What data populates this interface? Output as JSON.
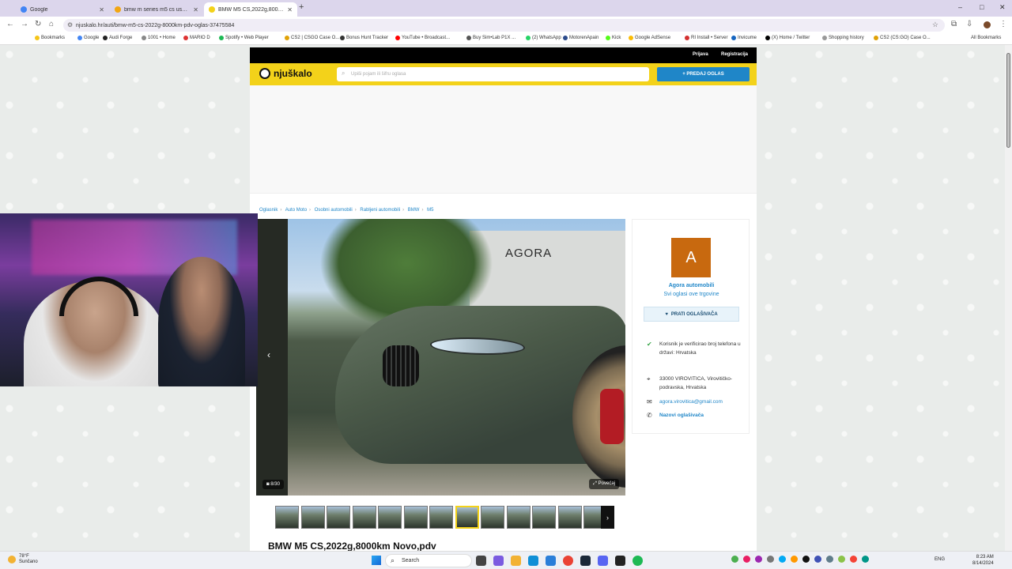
{
  "browser": {
    "tabs": [
      {
        "label": "Google",
        "active": false,
        "favicon_color": "#4285f4"
      },
      {
        "label": "bmw m series m5 cs used – Sea",
        "active": false,
        "favicon_color": "#f2a612"
      },
      {
        "label": "BMW M5 CS,2022g,8000km No...",
        "active": true,
        "favicon_color": "#f3d21a"
      }
    ],
    "new_tab": "+",
    "url": "njuskalo.hr/auti/bmw-m5-cs-2022g-8000km-pdv-oglas-37475584",
    "window_controls": [
      "–",
      "□",
      "✕"
    ],
    "bookmarks": [
      {
        "label": "Bookmarks",
        "color": "#f5c518"
      },
      {
        "label": "Google",
        "color": "#4285f4"
      },
      {
        "label": "Audi Forge",
        "color": "#222"
      },
      {
        "label": "1001 • Home",
        "color": "#888"
      },
      {
        "label": "MARIO D",
        "color": "#d33"
      },
      {
        "label": "Spotify • Web Player",
        "color": "#1db954"
      },
      {
        "label": "CS2 | CSGO Case O...",
        "color": "#e0a106"
      },
      {
        "label": "Bonus Hunt Tracker",
        "color": "#333"
      },
      {
        "label": "YouTube • Broadcast...",
        "color": "#ff0000"
      },
      {
        "label": "Buy Sim•Lab P1X ...",
        "color": "#555"
      },
      {
        "label": "(2) WhatsApp",
        "color": "#25d366"
      },
      {
        "label": "MotorenApain",
        "color": "#2b4a8b"
      },
      {
        "label": "Kick",
        "color": "#53fc18"
      },
      {
        "label": "Google AdSense",
        "color": "#fbbc04"
      },
      {
        "label": "RI Install • Server",
        "color": "#d32f2f"
      },
      {
        "label": "Invicume",
        "color": "#1565c0"
      },
      {
        "label": "(X) Home / Twitter",
        "color": "#000"
      },
      {
        "label": "Shopping history",
        "color": "#999"
      },
      {
        "label": "CS2 (CS:GO) Case O...",
        "color": "#e0a106"
      }
    ],
    "all_bookmarks": "All Bookmarks"
  },
  "site": {
    "top_links": {
      "login": "Prijava",
      "register": "Registracija"
    },
    "logo": "njuškalo",
    "search_placeholder": "Upiši pojam ili šifru oglasa",
    "sell_button": "+ PREDAJ OGLAS",
    "breadcrumb": [
      "Oglasnik",
      "Auto Moto",
      "Osobni automobili",
      "Rabljeni automobili",
      "BMW",
      "M5"
    ],
    "gallery": {
      "photo_counter": "8/30",
      "enlarge": "Povećaj",
      "sign_text": "AGORA",
      "prev": "‹",
      "next": "›",
      "thumb_count": 13,
      "selected_thumb": 7
    },
    "title": "BMW M5 CS,2022g,8000km Novo,pdv",
    "seller": {
      "avatar_letter": "A",
      "avatar_color": "#c8690f",
      "name": "Agora automobili",
      "all_ads": "Svi oglasi ove trgovine",
      "follow": "PRATI OGLAŠIVAČA",
      "verified": "Korisnik je verificirao broj telefona u državi: Hrvatska",
      "address": "33000 VIROVITICA, Virovitičko-podravska, Hrvatska",
      "email": "agora.virovitica@gmail.com",
      "call": "Nazovi oglašivača"
    }
  },
  "taskbar": {
    "weather_temp": "78°F",
    "weather_desc": "Sunčano",
    "search": "Search",
    "language": "ENG",
    "time": "8:23 AM",
    "date": "8/14/2024"
  }
}
